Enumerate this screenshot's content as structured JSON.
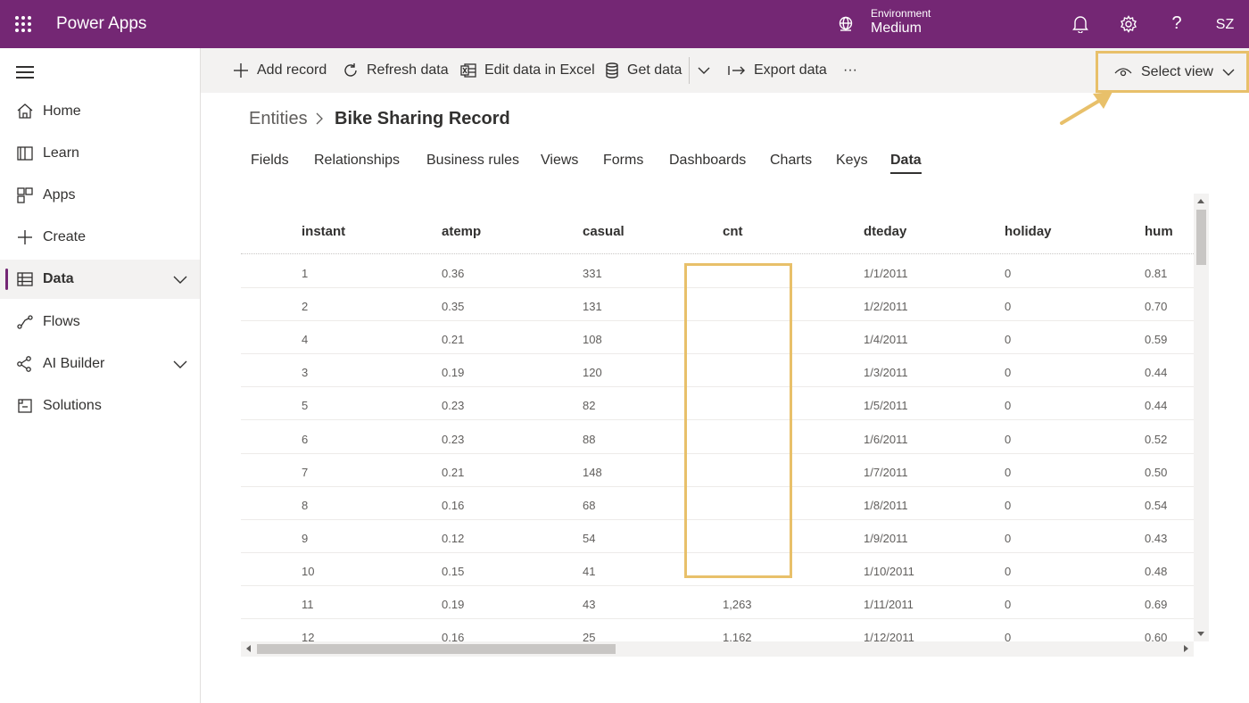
{
  "topbar": {
    "app_title": "Power Apps",
    "env_label": "Environment",
    "env_value": "Medium",
    "user_initials": "SZ",
    "help_glyph": "?"
  },
  "sidebar": {
    "items": [
      {
        "label": "Home",
        "icon": "home-icon"
      },
      {
        "label": "Learn",
        "icon": "book-icon"
      },
      {
        "label": "Apps",
        "icon": "apps-icon"
      },
      {
        "label": "Create",
        "icon": "plus-icon"
      },
      {
        "label": "Data",
        "icon": "table-icon",
        "active": true,
        "expandable": true
      },
      {
        "label": "Flows",
        "icon": "flow-icon"
      },
      {
        "label": "AI Builder",
        "icon": "ai-builder-icon",
        "expandable": true
      },
      {
        "label": "Solutions",
        "icon": "solutions-icon"
      }
    ]
  },
  "commands": {
    "add_record": "Add record",
    "refresh_data": "Refresh data",
    "edit_in_excel": "Edit data in Excel",
    "get_data": "Get data",
    "export_data": "Export data",
    "more": "···",
    "select_view": "Select view"
  },
  "breadcrumb": {
    "root": "Entities",
    "current": "Bike Sharing Record"
  },
  "tabs": [
    "Fields",
    "Relationships",
    "Business rules",
    "Views",
    "Forms",
    "Dashboards",
    "Charts",
    "Keys",
    "Data"
  ],
  "active_tab": "Data",
  "table": {
    "columns": [
      "instant",
      "atemp",
      "casual",
      "cnt",
      "dteday",
      "holiday",
      "hum"
    ],
    "rows": [
      [
        "1",
        "0.36",
        "331",
        "",
        "1/1/2011",
        "0",
        "0.81"
      ],
      [
        "2",
        "0.35",
        "131",
        "",
        "1/2/2011",
        "0",
        "0.70"
      ],
      [
        "4",
        "0.21",
        "108",
        "",
        "1/4/2011",
        "0",
        "0.59"
      ],
      [
        "3",
        "0.19",
        "120",
        "",
        "1/3/2011",
        "0",
        "0.44"
      ],
      [
        "5",
        "0.23",
        "82",
        "",
        "1/5/2011",
        "0",
        "0.44"
      ],
      [
        "6",
        "0.23",
        "88",
        "",
        "1/6/2011",
        "0",
        "0.52"
      ],
      [
        "7",
        "0.21",
        "148",
        "",
        "1/7/2011",
        "0",
        "0.50"
      ],
      [
        "8",
        "0.16",
        "68",
        "",
        "1/8/2011",
        "0",
        "0.54"
      ],
      [
        "9",
        "0.12",
        "54",
        "",
        "1/9/2011",
        "0",
        "0.43"
      ],
      [
        "10",
        "0.15",
        "41",
        "",
        "1/10/2011",
        "0",
        "0.48"
      ],
      [
        "11",
        "0.19",
        "43",
        "1,263",
        "1/11/2011",
        "0",
        "0.69"
      ],
      [
        "12",
        "0.16",
        "25",
        "1,162",
        "1/12/2011",
        "0",
        "0.60"
      ]
    ]
  },
  "colors": {
    "brand": "#742774",
    "annotation": "#e8c06a"
  }
}
